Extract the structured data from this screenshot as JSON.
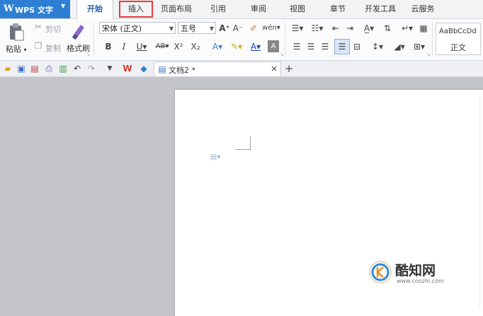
{
  "app": {
    "logo": "W",
    "title": "WPS 文字"
  },
  "tabs": [
    {
      "label": "开始",
      "active": true
    },
    {
      "label": "插入",
      "highlighted": true
    },
    {
      "label": "页面布局"
    },
    {
      "label": "引用"
    },
    {
      "label": "审阅"
    },
    {
      "label": "视图"
    },
    {
      "label": "章节"
    },
    {
      "label": "开发工具"
    },
    {
      "label": "云服务"
    }
  ],
  "ribbon": {
    "paste_label": "粘贴",
    "cut_label": "剪切",
    "copy_label": "复制",
    "format_painter_label": "格式刷",
    "font_name": "宋体 (正文)",
    "font_size": "五号",
    "style_preview": "AaBbCcDd",
    "style_name": "正文"
  },
  "document_tab": {
    "title": "文档2 *"
  },
  "watermark": {
    "brand": "酷知网",
    "url": "www.coozhi.com"
  }
}
